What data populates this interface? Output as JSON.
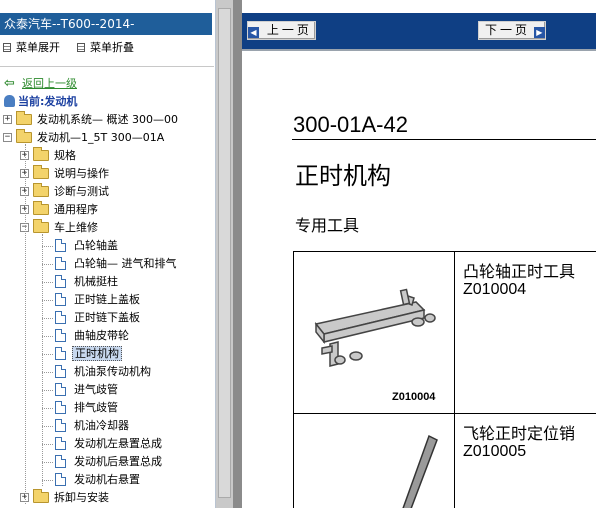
{
  "left_panel": {
    "title": "众泰汽车--T600--2014-",
    "toolbar": {
      "expand": "菜单展开",
      "collapse": "菜单折叠"
    },
    "back": "返回上一级",
    "current": "当前:发动机",
    "tree": [
      {
        "label": "发动机系统— 概述 300—00",
        "level": 0,
        "type": "folder",
        "toggle": "+"
      },
      {
        "label": "发动机—1_5T 300—01A",
        "level": 0,
        "type": "folder",
        "toggle": "-"
      },
      {
        "label": "规格",
        "level": 1,
        "type": "folder",
        "toggle": "+"
      },
      {
        "label": "说明与操作",
        "level": 1,
        "type": "folder",
        "toggle": "+"
      },
      {
        "label": "诊断与测试",
        "level": 1,
        "type": "folder",
        "toggle": "+"
      },
      {
        "label": "通用程序",
        "level": 1,
        "type": "folder",
        "toggle": "+"
      },
      {
        "label": "车上维修",
        "level": 1,
        "type": "folder",
        "toggle": "-"
      },
      {
        "label": "凸轮轴盖",
        "level": 2,
        "type": "doc"
      },
      {
        "label": "凸轮轴— 进气和排气",
        "level": 2,
        "type": "doc"
      },
      {
        "label": "机械挺柱",
        "level": 2,
        "type": "doc"
      },
      {
        "label": "正时链上盖板",
        "level": 2,
        "type": "doc"
      },
      {
        "label": "正时链下盖板",
        "level": 2,
        "type": "doc"
      },
      {
        "label": "曲轴皮带轮",
        "level": 2,
        "type": "doc"
      },
      {
        "label": "正时机构",
        "level": 2,
        "type": "doc",
        "selected": true
      },
      {
        "label": "机油泵传动机构",
        "level": 2,
        "type": "doc"
      },
      {
        "label": "进气歧管",
        "level": 2,
        "type": "doc"
      },
      {
        "label": "排气歧管",
        "level": 2,
        "type": "doc"
      },
      {
        "label": "机油冷却器",
        "level": 2,
        "type": "doc"
      },
      {
        "label": "发动机左悬置总成",
        "level": 2,
        "type": "doc"
      },
      {
        "label": "发动机后悬置总成",
        "level": 2,
        "type": "doc"
      },
      {
        "label": "发动机右悬置",
        "level": 2,
        "type": "doc"
      },
      {
        "label": "拆卸与安装",
        "level": 1,
        "type": "folder",
        "toggle": "+"
      }
    ]
  },
  "nav": {
    "prev": "上一页",
    "next": "下一页"
  },
  "document": {
    "code": "300-01A-42",
    "title": "正时机构",
    "subtitle": "专用工具",
    "tools": [
      {
        "name": "凸轮轴正时工具",
        "code": "Z010004",
        "image_code": "Z010004"
      },
      {
        "name": "飞轮正时定位销",
        "code": "Z010005"
      }
    ]
  },
  "colors": {
    "title_bar": "#1f5e9a",
    "nav_bar": "#0f3f84",
    "selection": "#c8d8ee"
  }
}
